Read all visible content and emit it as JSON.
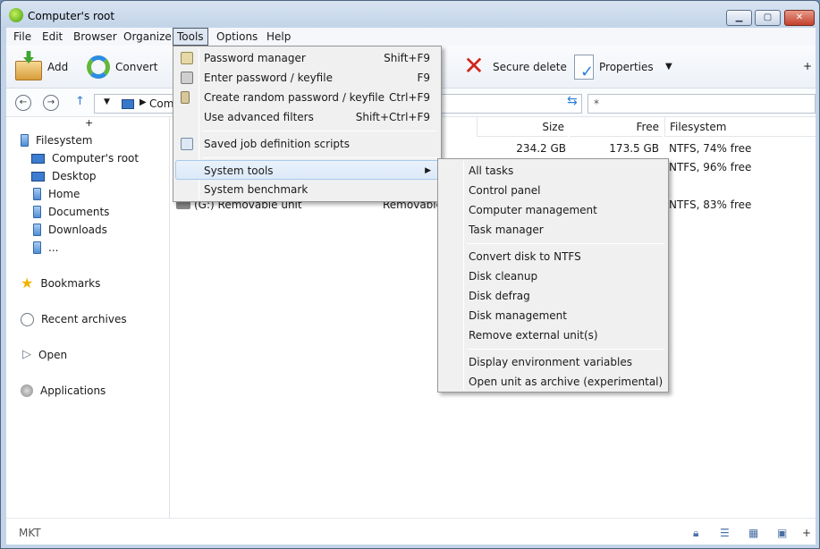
{
  "window": {
    "title": "Computer's root"
  },
  "menubar": [
    "File",
    "Edit",
    "Browser",
    "Organize",
    "Tools",
    "Options",
    "Help"
  ],
  "toolbar": {
    "add_label": "Add",
    "convert_label": "Convert",
    "secure_delete_label": "Secure delete",
    "properties_label": "Properties",
    "plus": "+"
  },
  "addressbar": {
    "path_text": "Com",
    "filter_value": "*"
  },
  "sidebar": {
    "plus": "+",
    "filesystem": "Filesystem",
    "items": [
      "Computer's root",
      "Desktop",
      "Home",
      "Documents",
      "Downloads",
      "..."
    ],
    "bookmarks": "Bookmarks",
    "recent": "Recent archives",
    "open": "Open",
    "applications": "Applications"
  },
  "table": {
    "headers": {
      "size": "Size",
      "free": "Free",
      "filesystem": "Filesystem"
    },
    "rows": [
      {
        "size": "234.2 GB",
        "free": "173.5 GB",
        "fs": "NTFS, 74% free"
      },
      {
        "fs": "NTFS, 96% free"
      },
      {
        "name": "(G:) Removable unit",
        "type": "Removable",
        "fs": "NTFS, 83% free"
      }
    ]
  },
  "tools_menu": [
    {
      "label": "Password manager",
      "shortcut": "Shift+F9"
    },
    {
      "label": "Enter password / keyfile",
      "shortcut": "F9"
    },
    {
      "label": "Create random password / keyfile",
      "shortcut": "Ctrl+F9"
    },
    {
      "label": "Use advanced filters",
      "shortcut": "Shift+Ctrl+F9"
    },
    {
      "label": "Saved job definition scripts",
      "shortcut": ""
    },
    {
      "label": "System tools",
      "shortcut": ""
    },
    {
      "label": "System benchmark",
      "shortcut": ""
    }
  ],
  "system_tools_menu": [
    "All tasks",
    "Control panel",
    "Computer management",
    "Task manager",
    "Convert disk to NTFS",
    "Disk cleanup",
    "Disk defrag",
    "Disk management",
    "Remove external unit(s)",
    "Display environment variables",
    "Open unit as archive (experimental)"
  ],
  "status": {
    "text": "MKT",
    "plus": "+"
  }
}
